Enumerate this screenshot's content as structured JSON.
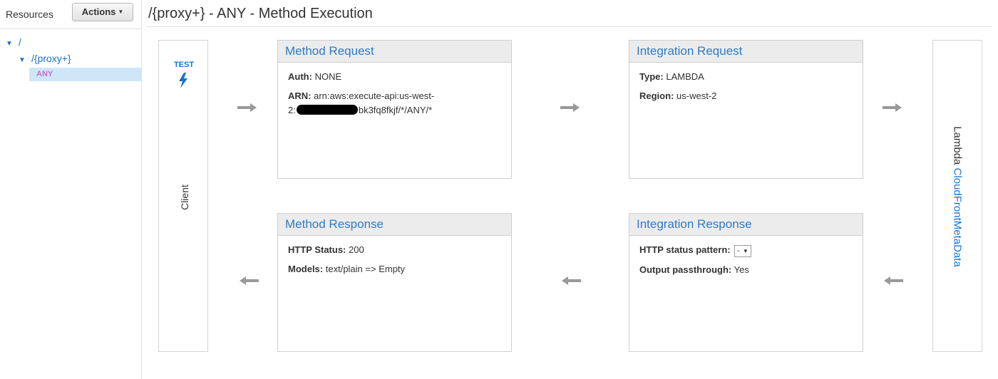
{
  "sidebar": {
    "title": "Resources",
    "actions_label": "Actions",
    "tree": {
      "root": "/",
      "child": "/{proxy+}",
      "method": "ANY"
    }
  },
  "page": {
    "title": "/{proxy+} - ANY - Method Execution"
  },
  "client": {
    "test_label": "TEST",
    "label": "Client"
  },
  "lambda": {
    "prefix": "Lambda",
    "function_name": "CloudFrontMetaData"
  },
  "method_request": {
    "title": "Method Request",
    "auth_label": "Auth:",
    "auth_value": "NONE",
    "arn_label": "ARN:",
    "arn_line1": "arn:aws:execute-api:us-west-",
    "arn_line2_prefix": "2:",
    "arn_line2_suffix": "bk3fq8fkjf/*/ANY/*"
  },
  "integration_request": {
    "title": "Integration Request",
    "type_label": "Type:",
    "type_value": "LAMBDA",
    "region_label": "Region:",
    "region_value": "us-west-2"
  },
  "method_response": {
    "title": "Method Response",
    "status_label": "HTTP Status:",
    "status_value": "200",
    "models_label": "Models:",
    "models_value": "text/plain => Empty"
  },
  "integration_response": {
    "title": "Integration Response",
    "pattern_label": "HTTP status pattern:",
    "pattern_value": "-",
    "passthrough_label": "Output passthrough:",
    "passthrough_value": "Yes"
  },
  "colors": {
    "link": "#1a73c9",
    "card_title": "#2e7bc4",
    "method_badge": "#c46bc9",
    "selected_row": "#cfe6f7",
    "arrow": "#999999"
  }
}
